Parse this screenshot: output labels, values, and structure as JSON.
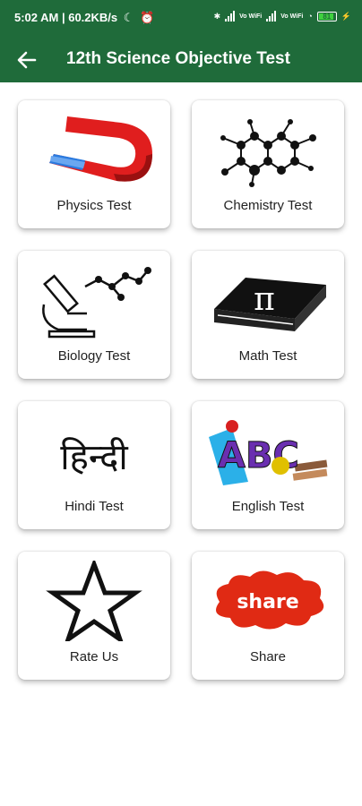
{
  "status": {
    "time": "5:02 AM | 60.2KB/s",
    "battery": "81",
    "volte1": "Vo WiFi",
    "volte2": "Vo WiFi"
  },
  "appbar": {
    "title": "12th Science Objective Test"
  },
  "cards": [
    {
      "label": "Physics Test"
    },
    {
      "label": "Chemistry Test"
    },
    {
      "label": "Biology Test"
    },
    {
      "label": "Math Test"
    },
    {
      "label": "Hindi Test"
    },
    {
      "label": "English Test"
    },
    {
      "label": "Rate Us"
    },
    {
      "label": "Share"
    }
  ],
  "art": {
    "hindi": "हिन्दी",
    "share": "share",
    "pi": "π",
    "abc": "ABC"
  },
  "colors": {
    "appbar": "#1f6b3a",
    "share": "#e02a14",
    "magnet_red": "#e01e1e",
    "magnet_blue": "#2a7be0"
  }
}
